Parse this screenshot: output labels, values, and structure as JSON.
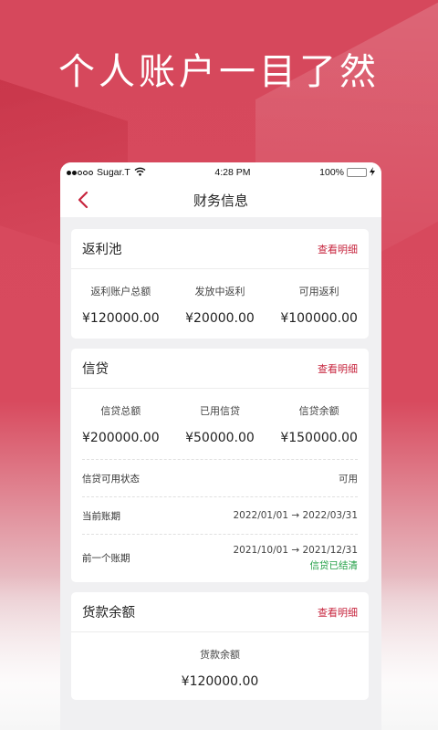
{
  "headline": "个人账户一目了然",
  "status_bar": {
    "carrier": "Sugar.T",
    "time": "4:28 PM",
    "battery": "100%"
  },
  "nav": {
    "title": "财务信息"
  },
  "rebate_pool": {
    "title": "返利池",
    "detail_link": "查看明细",
    "stats": [
      {
        "label": "返利账户总额",
        "value": "¥120000.00"
      },
      {
        "label": "发放中返利",
        "value": "¥20000.00"
      },
      {
        "label": "可用返利",
        "value": "¥100000.00"
      }
    ]
  },
  "credit": {
    "title": "信贷",
    "detail_link": "查看明细",
    "stats": [
      {
        "label": "信贷总额",
        "value": "¥200000.00"
      },
      {
        "label": "已用信贷",
        "value": "¥50000.00"
      },
      {
        "label": "信贷余额",
        "value": "¥150000.00"
      }
    ],
    "status": {
      "label": "信贷可用状态",
      "value": "可用"
    },
    "current_period": {
      "label": "当前账期",
      "value": "2022/01/01 → 2022/03/31"
    },
    "previous_period": {
      "label": "前一个账期",
      "value": "2021/10/01 → 2021/12/31",
      "note": "信贷已结清"
    }
  },
  "payment_balance": {
    "title": "货款余额",
    "detail_link": "查看明细",
    "stat": {
      "label": "货款余额",
      "value": "¥120000.00"
    }
  },
  "colors": {
    "brand": "#d6485c",
    "link": "#c7253e",
    "success": "#23a047"
  },
  "icons": [
    "back-chevron-icon",
    "wifi-icon",
    "signal-dots-icon",
    "battery-icon",
    "charging-icon"
  ]
}
